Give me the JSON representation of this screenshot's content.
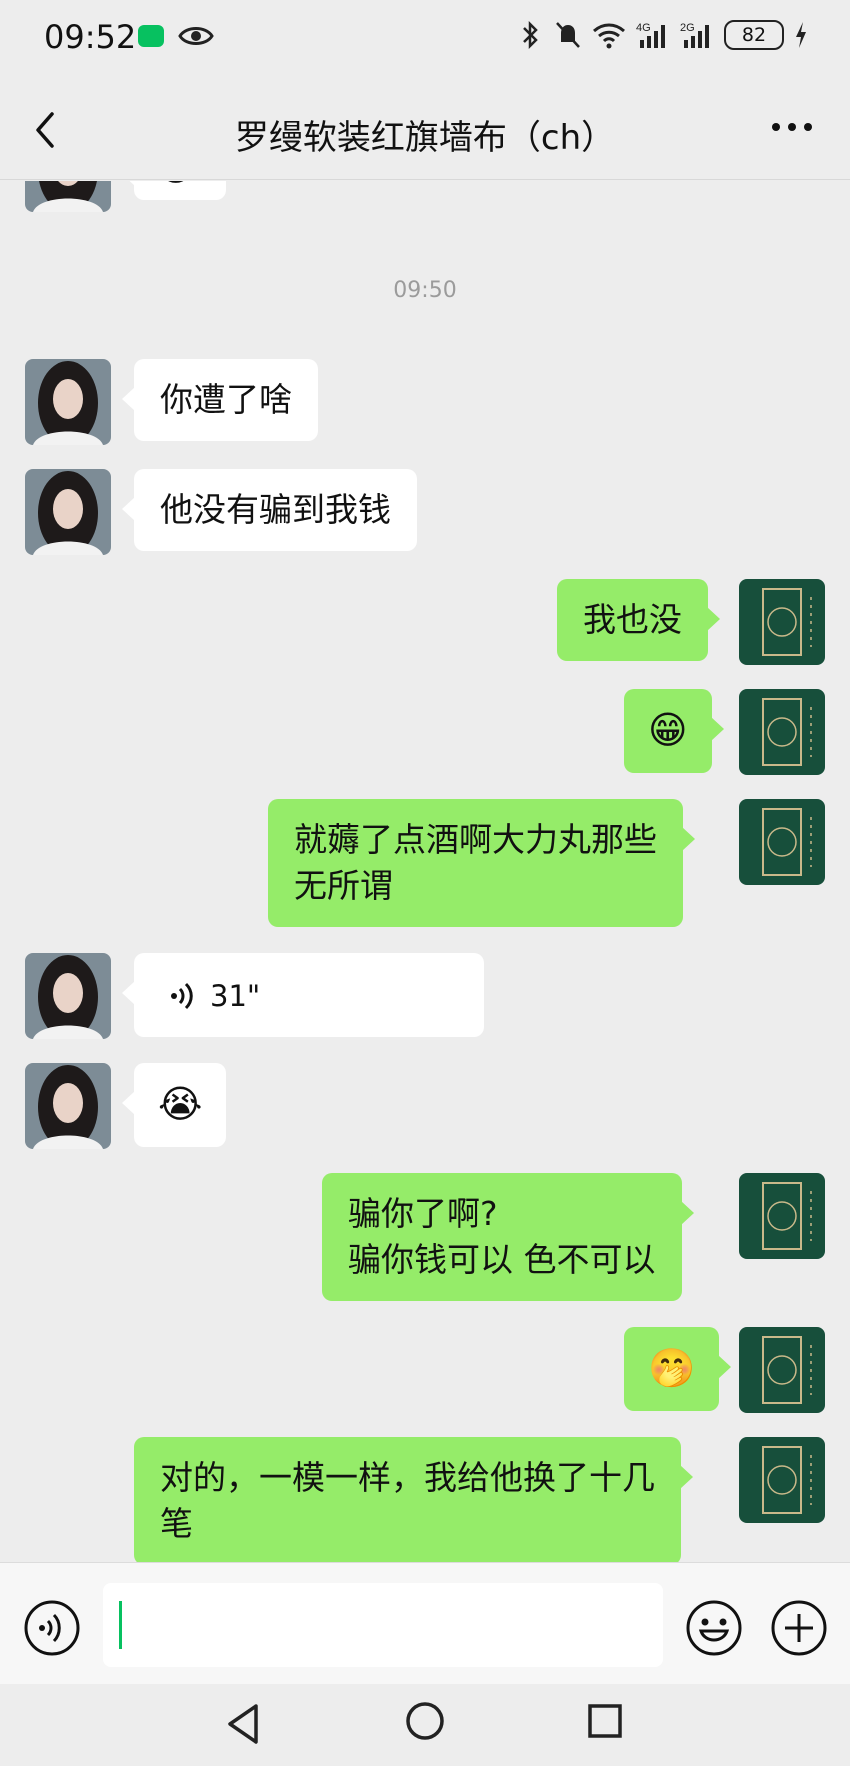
{
  "status_bar": {
    "time": "09:52",
    "battery": "82",
    "icons": [
      "wechat-icon",
      "eye-icon",
      "bluetooth-icon",
      "mute-bell-icon",
      "wifi-icon",
      "4g-signal-icon",
      "2g-signal-icon",
      "charging-icon"
    ]
  },
  "header": {
    "title": "罗缦软装红旗墙布（ch）",
    "back_icon": "back-chevron-icon",
    "more_icon": "more-dots-icon"
  },
  "chat": {
    "timestamp": "09:50",
    "messages": [
      {
        "side": "in",
        "type": "emoji",
        "text": "😁"
      },
      {
        "side": "in",
        "type": "text",
        "text": "你遭了啥"
      },
      {
        "side": "in",
        "type": "text",
        "text": "他没有骗到我钱"
      },
      {
        "side": "out",
        "type": "text",
        "text": "我也没"
      },
      {
        "side": "out",
        "type": "emoji",
        "text": "😁"
      },
      {
        "side": "out",
        "type": "text",
        "line1": "就薅了点酒啊大力丸那些",
        "line2": "无所谓"
      },
      {
        "side": "in",
        "type": "voice",
        "duration": "31\""
      },
      {
        "side": "in",
        "type": "emoji",
        "text": "😭"
      },
      {
        "side": "out",
        "type": "text",
        "line1": "骗你了啊?",
        "line2": "骗你钱可以  色不可以"
      },
      {
        "side": "out",
        "type": "emoji",
        "text": "🤭"
      },
      {
        "side": "out",
        "type": "text",
        "line1": "对的，一模一样，我给他换了十几",
        "line2": "笔"
      }
    ]
  },
  "input_bar": {
    "voice_icon": "voice-input-icon",
    "emoji_icon": "emoji-icon",
    "plus_icon": "plus-icon",
    "value": ""
  },
  "nav_bar": {
    "icons": [
      "nav-back-icon",
      "nav-home-icon",
      "nav-recent-icon"
    ]
  },
  "colors": {
    "background": "#ededed",
    "incoming_bubble": "#ffffff",
    "outgoing_bubble": "#95ec69",
    "accent": "#07c160",
    "timestamp": "#9b9b9b"
  }
}
